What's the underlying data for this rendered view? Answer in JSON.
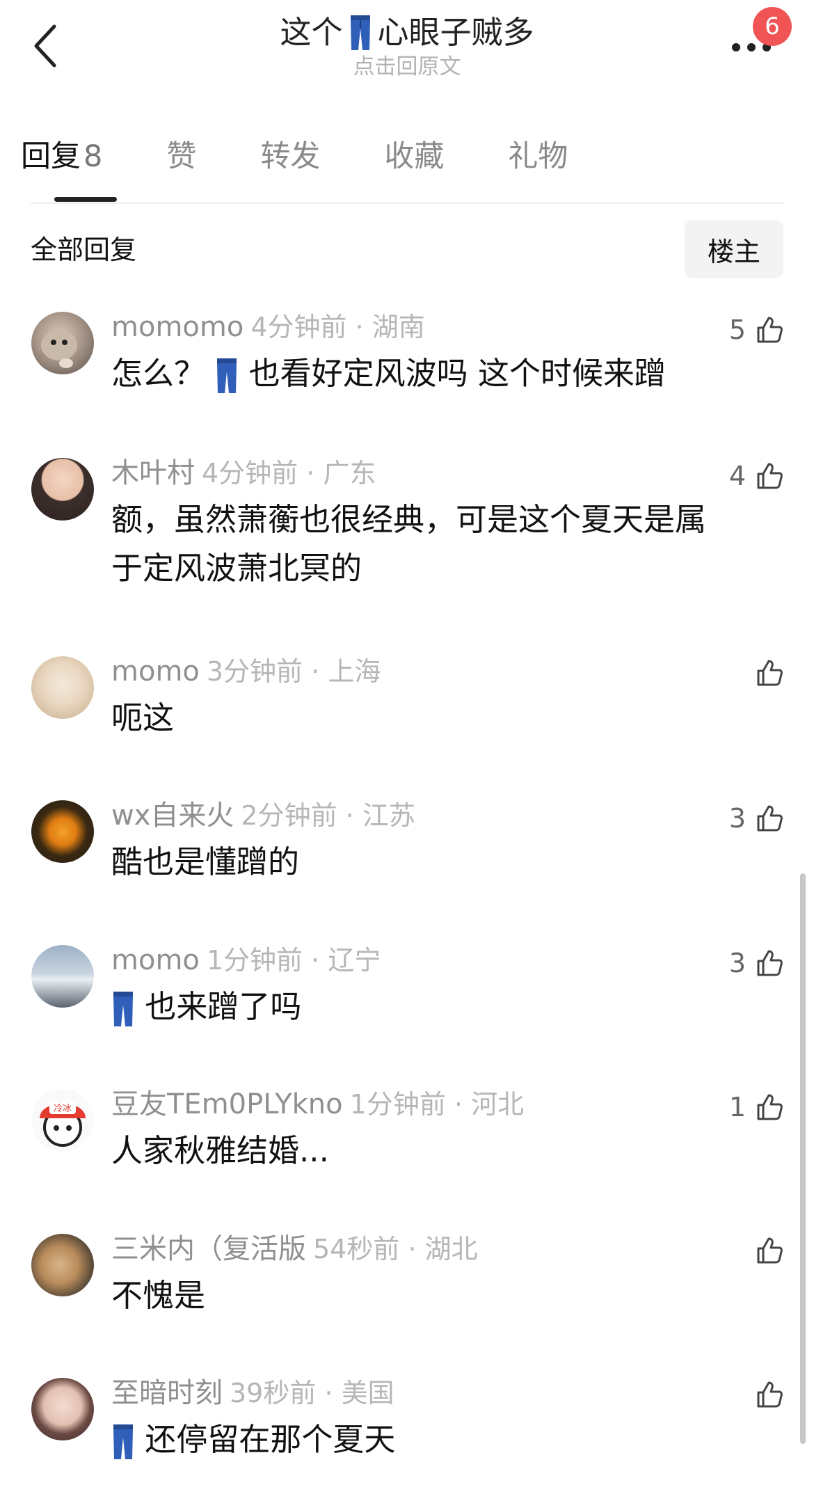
{
  "header": {
    "title_prefix": "这个",
    "title_suffix": "心眼子贼多",
    "subtitle": "点击回原文",
    "badge_count": "6"
  },
  "tabs": [
    {
      "label": "回复",
      "count": "8"
    },
    {
      "label": "赞"
    },
    {
      "label": "转发"
    },
    {
      "label": "收藏"
    },
    {
      "label": "礼物"
    }
  ],
  "section": {
    "title": "全部回复",
    "op_filter": "楼主"
  },
  "comments": [
    {
      "user": "momomo",
      "time": "4分钟前",
      "location": "湖南",
      "likes": "5",
      "text_before": "怎么？",
      "text_after": "也看好定风波吗 这个时候来蹭"
    },
    {
      "user": "木叶村",
      "time": "4分钟前",
      "location": "广东",
      "likes": "4",
      "text_line1": "额，虽然萧蘅也很经典，可是这个夏天是属",
      "text_line2": "于定风波萧北冥的"
    },
    {
      "user": "momo",
      "time": "3分钟前",
      "location": "上海",
      "likes": "",
      "text": "呃这"
    },
    {
      "user": "wx自来火",
      "time": "2分钟前",
      "location": "江苏",
      "likes": "3",
      "text": "酷也是懂蹭的"
    },
    {
      "user": "momo",
      "time": "1分钟前",
      "location": "辽宁",
      "likes": "3",
      "text": "也来蹭了吗"
    },
    {
      "user": "豆友TEm0PLYkno",
      "time": "1分钟前",
      "location": "河北",
      "likes": "1",
      "text": "人家秋雅结婚...",
      "avatar_label": "冷冰"
    },
    {
      "user": "三米内（复活版",
      "time": "54秒前",
      "location": "湖北",
      "likes": "",
      "text": "不愧是"
    },
    {
      "user": "至暗时刻",
      "time": "39秒前",
      "location": "美国",
      "likes": "",
      "text": "还停留在那个夏天"
    }
  ],
  "sep": " · ",
  "colors": {
    "badge": "#f05454",
    "username": "#8f8f8f",
    "meta": "#b6b6b6",
    "jeans": "#2f5fb8"
  }
}
